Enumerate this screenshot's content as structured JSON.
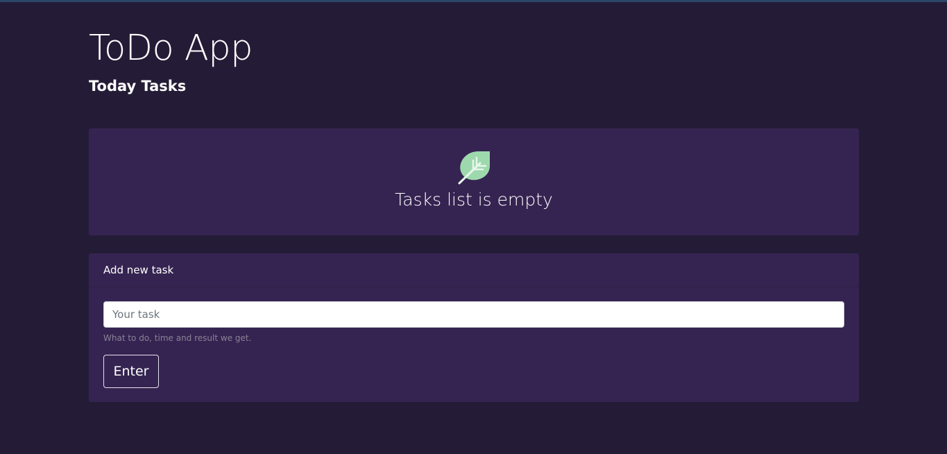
{
  "app": {
    "title": "ToDo App",
    "subtitle": "Today Tasks"
  },
  "empty_state": {
    "icon": "leaf-icon",
    "message": "Tasks list is empty"
  },
  "add_task_form": {
    "header": "Add new task",
    "input": {
      "value": "",
      "placeholder": "Your task"
    },
    "help_text": "What to do, time and result we get.",
    "submit_label": "Enter"
  },
  "colors": {
    "background": "#241c37",
    "card": "#352451",
    "leaf": "#9ed9ad",
    "text": "#ffffff"
  }
}
